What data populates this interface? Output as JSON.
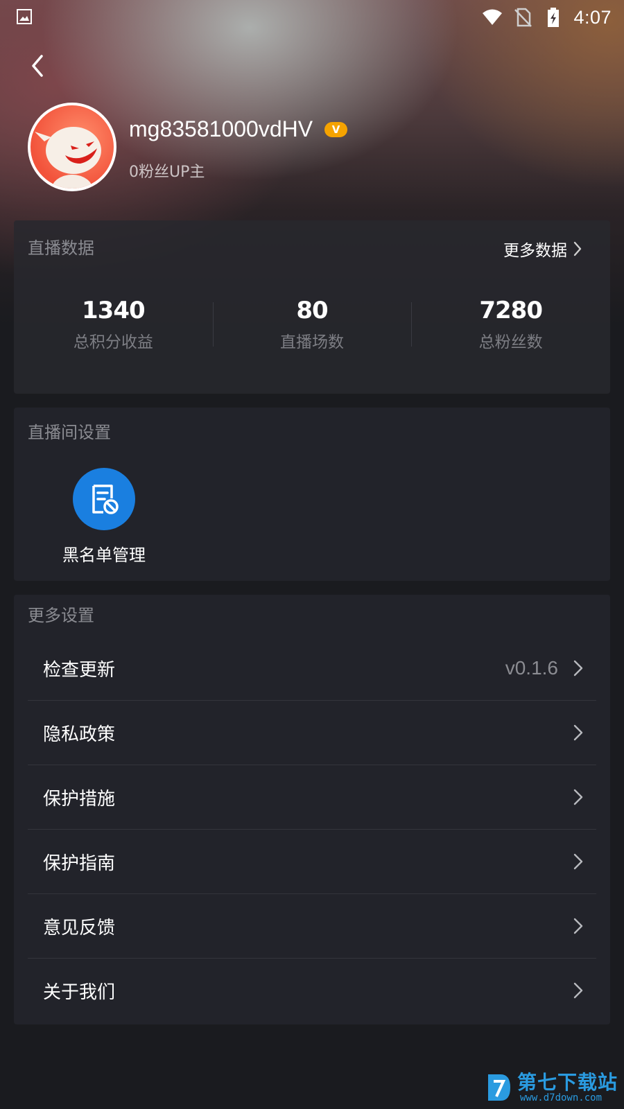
{
  "status_bar": {
    "time": "4:07",
    "icons": [
      "gallery-icon",
      "wifi-icon",
      "no-sim-icon",
      "battery-charging-icon"
    ]
  },
  "header": {
    "back_icon": "chevron-left-icon"
  },
  "profile": {
    "username": "mg83581000vdHV",
    "badge_text": "V",
    "badge_color": "#f5a300",
    "subtitle": "0粉丝UP主"
  },
  "live_data": {
    "title": "直播数据",
    "more_label": "更多数据",
    "stats": [
      {
        "value": "1340",
        "label": "总积分收益"
      },
      {
        "value": "80",
        "label": "直播场数"
      },
      {
        "value": "7280",
        "label": "总粉丝数"
      }
    ]
  },
  "room_settings": {
    "title": "直播间设置",
    "tools": [
      {
        "label": "黑名单管理",
        "icon": "blacklist-icon",
        "color": "#1a7fe0"
      }
    ]
  },
  "more_settings": {
    "title": "更多设置",
    "items": [
      {
        "label": "检查更新",
        "value": "v0.1.6"
      },
      {
        "label": "隐私政策"
      },
      {
        "label": "保护措施"
      },
      {
        "label": "保护指南"
      },
      {
        "label": "意见反馈"
      },
      {
        "label": "关于我们"
      }
    ]
  },
  "watermark": {
    "name": "第七下载站",
    "url": "www.d7down.com"
  }
}
